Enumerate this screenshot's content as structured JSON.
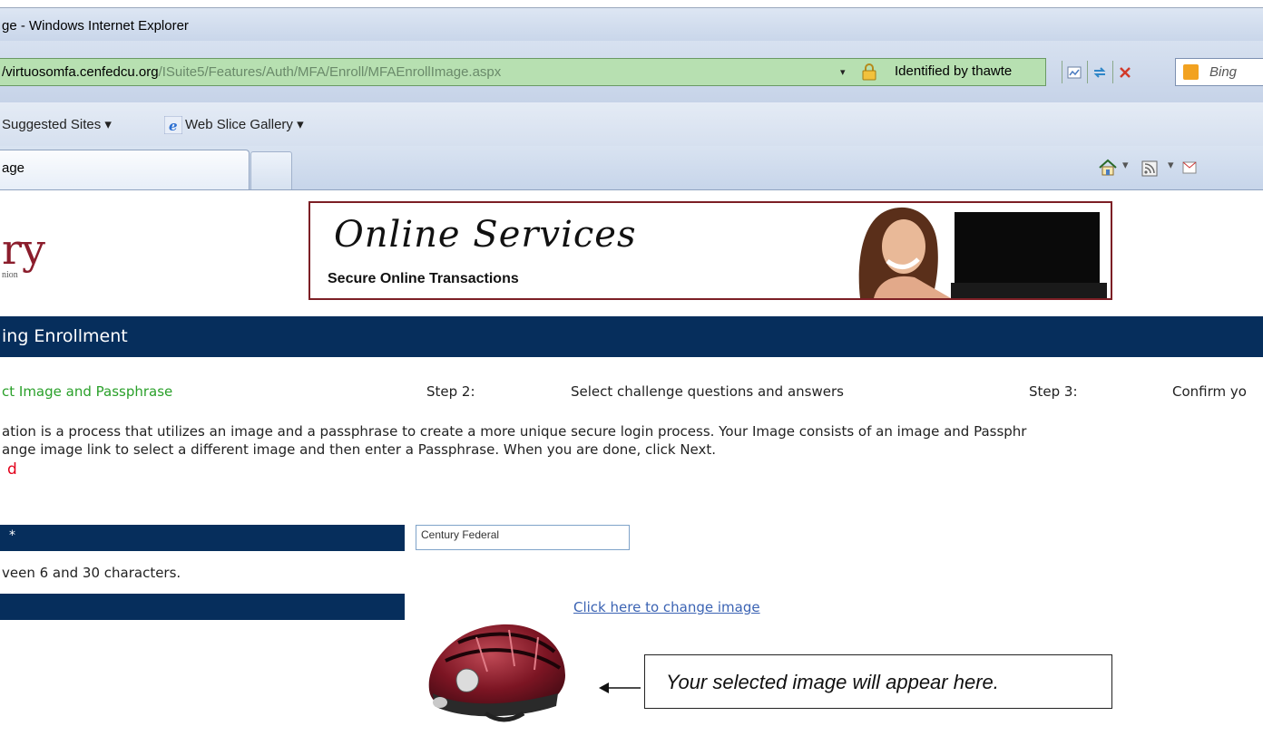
{
  "browser": {
    "title": "ge - Windows Internet Explorer",
    "url_host": "/virtuosomfa.cenfedcu.org",
    "url_path": "/ISuite5/Features/Auth/MFA/Enroll/MFAEnrollImage.aspx",
    "security": "Identified by thawte",
    "search_engine": "Bing",
    "favorites": {
      "suggested_sites": "Suggested Sites",
      "web_slice_gallery": "Web Slice Gallery"
    },
    "tab_label": "age",
    "dropdown_glyph": "▾"
  },
  "site": {
    "logo_fragment": "ry",
    "logo_sub": "nion",
    "banner_title": "Online Services",
    "banner_subtitle": "Secure Online Transactions"
  },
  "nav": {
    "title": "ing Enrollment"
  },
  "steps": {
    "step1_label": "ct Image and Passphrase",
    "step2_num": "Step 2:",
    "step2_label": "Select challenge questions and answers",
    "step3_num": "Step 3:",
    "step3_label": "Confirm yo"
  },
  "description": {
    "line1": "ation is a process that utilizes an image and a passphrase to create a more unique secure login process. Your Image consists of an image and Passphr",
    "line2": "ange image link to select a different image and then enter a Passphrase. When you are done, click Next."
  },
  "form": {
    "required_note": "d",
    "passphrase_label": "*",
    "passphrase_value": "Century Federal",
    "passphrase_hint": "veen 6 and 30 characters.",
    "change_image_link": "Click here to change image"
  },
  "callout": {
    "text": "Your selected image will appear here."
  },
  "colors": {
    "navy": "#062e5c",
    "banner_border": "#7c1f25",
    "active_step": "#2aa02a",
    "required": "#e2001a",
    "link": "#3b63b3"
  }
}
